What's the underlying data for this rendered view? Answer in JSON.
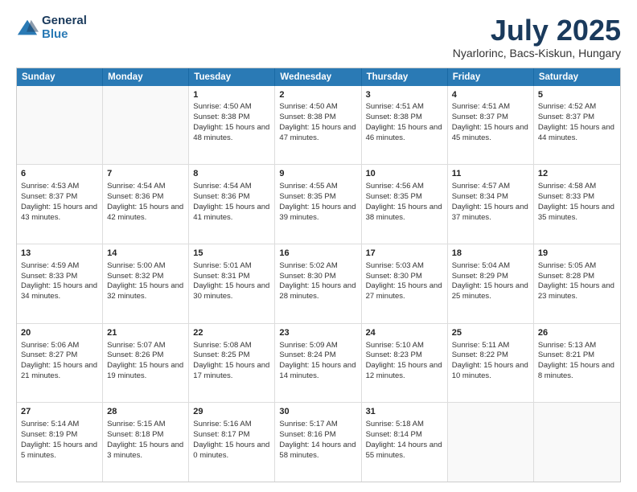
{
  "logo": {
    "general": "General",
    "blue": "Blue"
  },
  "title": "July 2025",
  "location": "Nyarlorinc, Bacs-Kiskun, Hungary",
  "days_of_week": [
    "Sunday",
    "Monday",
    "Tuesday",
    "Wednesday",
    "Thursday",
    "Friday",
    "Saturday"
  ],
  "weeks": [
    [
      {
        "day": "",
        "sunrise": "",
        "sunset": "",
        "daylight": ""
      },
      {
        "day": "",
        "sunrise": "",
        "sunset": "",
        "daylight": ""
      },
      {
        "day": "1",
        "sunrise": "Sunrise: 4:50 AM",
        "sunset": "Sunset: 8:38 PM",
        "daylight": "Daylight: 15 hours and 48 minutes."
      },
      {
        "day": "2",
        "sunrise": "Sunrise: 4:50 AM",
        "sunset": "Sunset: 8:38 PM",
        "daylight": "Daylight: 15 hours and 47 minutes."
      },
      {
        "day": "3",
        "sunrise": "Sunrise: 4:51 AM",
        "sunset": "Sunset: 8:38 PM",
        "daylight": "Daylight: 15 hours and 46 minutes."
      },
      {
        "day": "4",
        "sunrise": "Sunrise: 4:51 AM",
        "sunset": "Sunset: 8:37 PM",
        "daylight": "Daylight: 15 hours and 45 minutes."
      },
      {
        "day": "5",
        "sunrise": "Sunrise: 4:52 AM",
        "sunset": "Sunset: 8:37 PM",
        "daylight": "Daylight: 15 hours and 44 minutes."
      }
    ],
    [
      {
        "day": "6",
        "sunrise": "Sunrise: 4:53 AM",
        "sunset": "Sunset: 8:37 PM",
        "daylight": "Daylight: 15 hours and 43 minutes."
      },
      {
        "day": "7",
        "sunrise": "Sunrise: 4:54 AM",
        "sunset": "Sunset: 8:36 PM",
        "daylight": "Daylight: 15 hours and 42 minutes."
      },
      {
        "day": "8",
        "sunrise": "Sunrise: 4:54 AM",
        "sunset": "Sunset: 8:36 PM",
        "daylight": "Daylight: 15 hours and 41 minutes."
      },
      {
        "day": "9",
        "sunrise": "Sunrise: 4:55 AM",
        "sunset": "Sunset: 8:35 PM",
        "daylight": "Daylight: 15 hours and 39 minutes."
      },
      {
        "day": "10",
        "sunrise": "Sunrise: 4:56 AM",
        "sunset": "Sunset: 8:35 PM",
        "daylight": "Daylight: 15 hours and 38 minutes."
      },
      {
        "day": "11",
        "sunrise": "Sunrise: 4:57 AM",
        "sunset": "Sunset: 8:34 PM",
        "daylight": "Daylight: 15 hours and 37 minutes."
      },
      {
        "day": "12",
        "sunrise": "Sunrise: 4:58 AM",
        "sunset": "Sunset: 8:33 PM",
        "daylight": "Daylight: 15 hours and 35 minutes."
      }
    ],
    [
      {
        "day": "13",
        "sunrise": "Sunrise: 4:59 AM",
        "sunset": "Sunset: 8:33 PM",
        "daylight": "Daylight: 15 hours and 34 minutes."
      },
      {
        "day": "14",
        "sunrise": "Sunrise: 5:00 AM",
        "sunset": "Sunset: 8:32 PM",
        "daylight": "Daylight: 15 hours and 32 minutes."
      },
      {
        "day": "15",
        "sunrise": "Sunrise: 5:01 AM",
        "sunset": "Sunset: 8:31 PM",
        "daylight": "Daylight: 15 hours and 30 minutes."
      },
      {
        "day": "16",
        "sunrise": "Sunrise: 5:02 AM",
        "sunset": "Sunset: 8:30 PM",
        "daylight": "Daylight: 15 hours and 28 minutes."
      },
      {
        "day": "17",
        "sunrise": "Sunrise: 5:03 AM",
        "sunset": "Sunset: 8:30 PM",
        "daylight": "Daylight: 15 hours and 27 minutes."
      },
      {
        "day": "18",
        "sunrise": "Sunrise: 5:04 AM",
        "sunset": "Sunset: 8:29 PM",
        "daylight": "Daylight: 15 hours and 25 minutes."
      },
      {
        "day": "19",
        "sunrise": "Sunrise: 5:05 AM",
        "sunset": "Sunset: 8:28 PM",
        "daylight": "Daylight: 15 hours and 23 minutes."
      }
    ],
    [
      {
        "day": "20",
        "sunrise": "Sunrise: 5:06 AM",
        "sunset": "Sunset: 8:27 PM",
        "daylight": "Daylight: 15 hours and 21 minutes."
      },
      {
        "day": "21",
        "sunrise": "Sunrise: 5:07 AM",
        "sunset": "Sunset: 8:26 PM",
        "daylight": "Daylight: 15 hours and 19 minutes."
      },
      {
        "day": "22",
        "sunrise": "Sunrise: 5:08 AM",
        "sunset": "Sunset: 8:25 PM",
        "daylight": "Daylight: 15 hours and 17 minutes."
      },
      {
        "day": "23",
        "sunrise": "Sunrise: 5:09 AM",
        "sunset": "Sunset: 8:24 PM",
        "daylight": "Daylight: 15 hours and 14 minutes."
      },
      {
        "day": "24",
        "sunrise": "Sunrise: 5:10 AM",
        "sunset": "Sunset: 8:23 PM",
        "daylight": "Daylight: 15 hours and 12 minutes."
      },
      {
        "day": "25",
        "sunrise": "Sunrise: 5:11 AM",
        "sunset": "Sunset: 8:22 PM",
        "daylight": "Daylight: 15 hours and 10 minutes."
      },
      {
        "day": "26",
        "sunrise": "Sunrise: 5:13 AM",
        "sunset": "Sunset: 8:21 PM",
        "daylight": "Daylight: 15 hours and 8 minutes."
      }
    ],
    [
      {
        "day": "27",
        "sunrise": "Sunrise: 5:14 AM",
        "sunset": "Sunset: 8:19 PM",
        "daylight": "Daylight: 15 hours and 5 minutes."
      },
      {
        "day": "28",
        "sunrise": "Sunrise: 5:15 AM",
        "sunset": "Sunset: 8:18 PM",
        "daylight": "Daylight: 15 hours and 3 minutes."
      },
      {
        "day": "29",
        "sunrise": "Sunrise: 5:16 AM",
        "sunset": "Sunset: 8:17 PM",
        "daylight": "Daylight: 15 hours and 0 minutes."
      },
      {
        "day": "30",
        "sunrise": "Sunrise: 5:17 AM",
        "sunset": "Sunset: 8:16 PM",
        "daylight": "Daylight: 14 hours and 58 minutes."
      },
      {
        "day": "31",
        "sunrise": "Sunrise: 5:18 AM",
        "sunset": "Sunset: 8:14 PM",
        "daylight": "Daylight: 14 hours and 55 minutes."
      },
      {
        "day": "",
        "sunrise": "",
        "sunset": "",
        "daylight": ""
      },
      {
        "day": "",
        "sunrise": "",
        "sunset": "",
        "daylight": ""
      }
    ]
  ]
}
